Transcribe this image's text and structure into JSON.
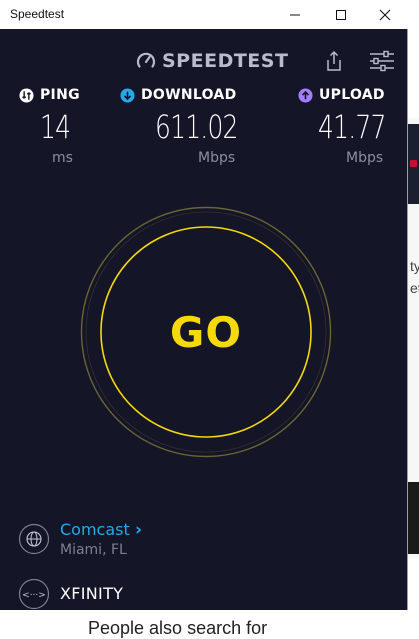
{
  "window": {
    "title": "Speedtest"
  },
  "header": {
    "brand": "SPEEDTEST"
  },
  "metrics": {
    "ping": {
      "label": "PING",
      "value": "14",
      "unit": "ms"
    },
    "download": {
      "label": "DOWNLOAD",
      "value": "611.02",
      "unit": "Mbps"
    },
    "upload": {
      "label": "UPLOAD",
      "value": "41.77",
      "unit": "Mbps"
    }
  },
  "go_button": {
    "label": "GO"
  },
  "isp": {
    "name": "Comcast",
    "location": "Miami, FL"
  },
  "host": {
    "name": "XFINITY"
  },
  "background": {
    "bottom_text": "People also search for",
    "glyph_1": "ty",
    "glyph_2": "et"
  },
  "colors": {
    "app_background": "#141526",
    "go_yellow": "#f5d90a",
    "ring_outer": "#6b6433",
    "ring_inner": "#f5d90a",
    "download_accent": "#27a8e8",
    "upload_accent": "#a77dff",
    "isp_link": "#27a8e8"
  },
  "icons": {
    "ping": "ping-icon",
    "download": "download-arrow-icon",
    "upload": "upload-arrow-icon",
    "share": "share-icon",
    "settings": "settings-sliders-icon",
    "isp": "globe-icon",
    "host": "server-link-icon"
  }
}
